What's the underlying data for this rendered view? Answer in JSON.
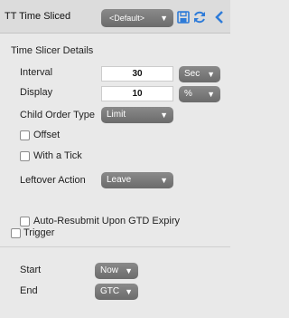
{
  "header": {
    "title": "TT Time Sliced",
    "template_select": "<Default>",
    "save_icon": "save-icon",
    "refresh_icon": "refresh-icon",
    "collapse_icon": "chevron-left-icon",
    "accent_color": "#2e7bd8"
  },
  "slicer": {
    "section_title": "Time Slicer Details",
    "interval_label": "Interval",
    "interval_value": "30",
    "interval_unit": "Sec",
    "display_label": "Display",
    "display_value": "10",
    "display_unit": "%",
    "child_order_type_label": "Child Order Type",
    "child_order_type_value": "Limit",
    "offset_label": "Offset",
    "with_tick_label": "With a Tick",
    "leftover_action_label": "Leftover Action",
    "leftover_action_value": "Leave",
    "auto_resubmit_label": "Auto-Resubmit Upon GTD Expiry"
  },
  "trigger": {
    "label": "Trigger"
  },
  "timing": {
    "start_label": "Start",
    "start_value": "Now",
    "end_label": "End",
    "end_value": "GTC"
  }
}
